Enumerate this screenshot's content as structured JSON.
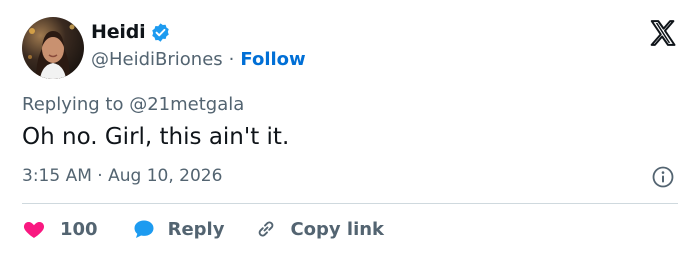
{
  "author": {
    "display_name": "Heidi",
    "handle": "@HeidiBriones",
    "separator": "·",
    "follow_label": "Follow"
  },
  "reply_context": {
    "prefix": "Replying to",
    "handle": "@21metgala"
  },
  "tweet": {
    "text": "Oh no. Girl, this ain't it.",
    "time": "3:15 AM",
    "separator": "·",
    "date": "Aug 10, 2026"
  },
  "actions": {
    "like_count": "100",
    "reply_label": "Reply",
    "copy_label": "Copy link"
  },
  "icons": {
    "brand": "x-logo-icon",
    "verified": "verified-badge-icon",
    "info": "info-icon",
    "like": "heart-icon",
    "reply": "reply-bubble-icon",
    "copy": "link-icon"
  },
  "colors": {
    "text": "#0f1419",
    "secondary": "#536471",
    "follow": "#006fd6",
    "verified": "#1d9bf0",
    "like": "#f91880",
    "reply": "#1d9bf0",
    "divider": "#cfd9de"
  }
}
